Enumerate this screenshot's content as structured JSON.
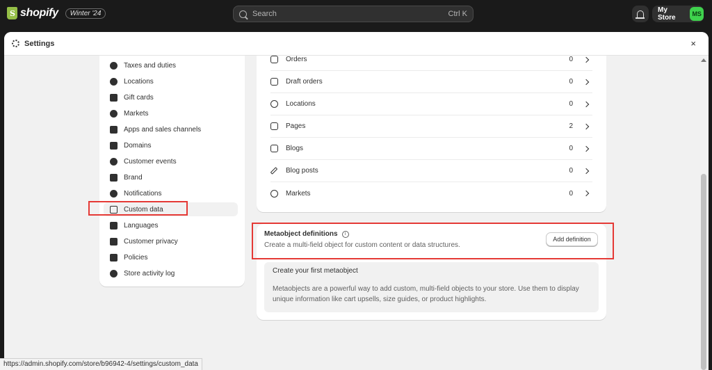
{
  "topbar": {
    "logo_text": "shopify",
    "edition": "Winter '24",
    "search_placeholder": "Search",
    "search_shortcut": "Ctrl K",
    "store_name": "My Store",
    "avatar_initials": "MS"
  },
  "settings": {
    "title": "Settings",
    "close_label": "×"
  },
  "nav": {
    "items": [
      {
        "label": "Taxes and duties"
      },
      {
        "label": "Locations"
      },
      {
        "label": "Gift cards"
      },
      {
        "label": "Markets"
      },
      {
        "label": "Apps and sales channels"
      },
      {
        "label": "Domains"
      },
      {
        "label": "Customer events"
      },
      {
        "label": "Brand"
      },
      {
        "label": "Notifications"
      },
      {
        "label": "Custom data"
      },
      {
        "label": "Languages"
      },
      {
        "label": "Customer privacy"
      },
      {
        "label": "Policies"
      },
      {
        "label": "Store activity log"
      }
    ],
    "active": "Custom data"
  },
  "definitions": {
    "rows": [
      {
        "label": "Orders",
        "count": "0"
      },
      {
        "label": "Draft orders",
        "count": "0"
      },
      {
        "label": "Locations",
        "count": "0"
      },
      {
        "label": "Pages",
        "count": "2"
      },
      {
        "label": "Blogs",
        "count": "0"
      },
      {
        "label": "Blog posts",
        "count": "0"
      },
      {
        "label": "Markets",
        "count": "0"
      }
    ]
  },
  "metaobjects": {
    "title": "Metaobject definitions",
    "description": "Create a multi-field object for custom content or data structures.",
    "add_button": "Add definition",
    "empty_title": "Create your first metaobject",
    "empty_text": "Metaobjects are a powerful way to add custom, multi-field objects to your store. Use them to display unique information like cart upsells, size guides, or product highlights."
  },
  "status_bar": {
    "url": "https://admin.shopify.com/store/b96942-4/settings/custom_data"
  },
  "colors": {
    "topbar": "#1a1a1a",
    "avatar": "#3fd24d",
    "highlight": "#e53935",
    "logo_green": "#95bf47"
  }
}
